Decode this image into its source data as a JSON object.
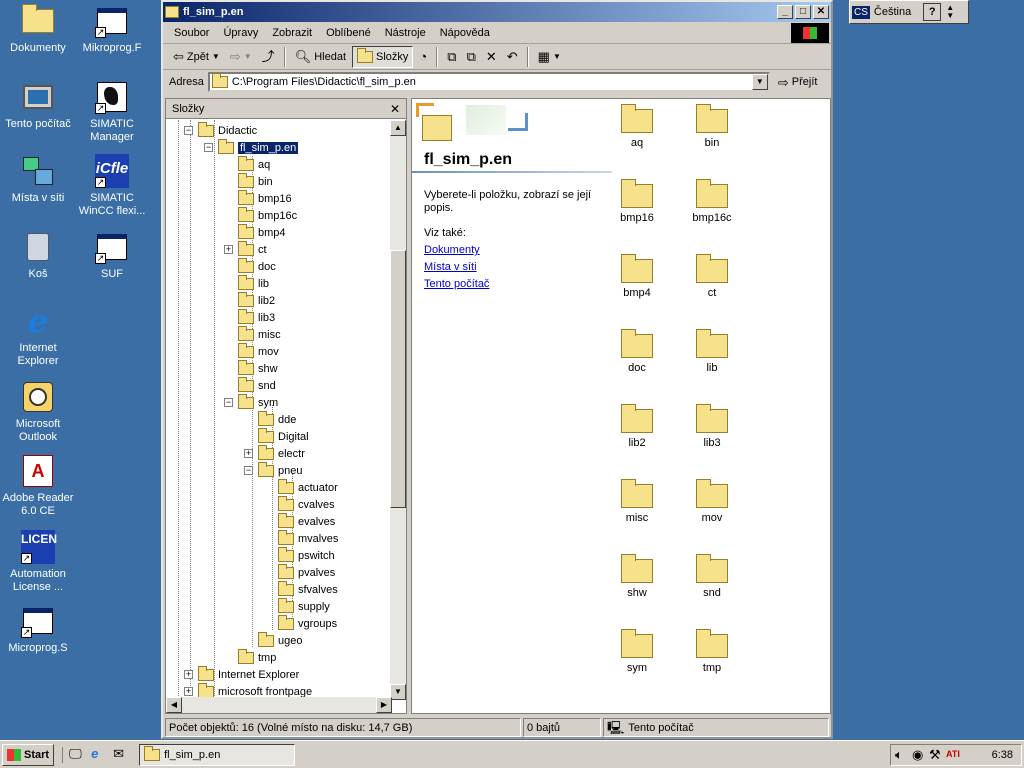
{
  "desktop": {
    "icons": [
      {
        "label": "Dokumenty",
        "icon": "my-documents-icon"
      },
      {
        "label": "Mikroprog.F",
        "icon": "mikroprog-f-icon"
      },
      {
        "label": "Tento počítač",
        "icon": "my-computer-icon"
      },
      {
        "label": "SIMATIC Manager",
        "icon": "simatic-manager-icon"
      },
      {
        "label": "Místa v síti",
        "icon": "network-places-icon"
      },
      {
        "label": "SIMATIC WinCC flexi...",
        "icon": "simatic-wincc-icon"
      },
      {
        "label": "Koš",
        "icon": "recycle-bin-icon"
      },
      {
        "label": "SUF",
        "icon": "suf-icon"
      },
      {
        "label": "Internet Explorer",
        "icon": "internet-explorer-icon"
      },
      {
        "label": "Microsoft Outlook",
        "icon": "outlook-icon"
      },
      {
        "label": "Adobe Reader 6.0 CE",
        "icon": "adobe-reader-icon"
      },
      {
        "label": "Automation License ...",
        "icon": "automation-license-icon"
      },
      {
        "label": "Microprog.S",
        "icon": "microprog-s-icon"
      }
    ],
    "icon_glyph_text": {
      "adobe": "A",
      "licen": "LICEN",
      "wincc": "iCfle"
    }
  },
  "langbar": {
    "code": "CS",
    "language": "Čeština",
    "help": "?"
  },
  "window": {
    "title": "fl_sim_p.en",
    "menu": [
      "Soubor",
      "Úpravy",
      "Zobrazit",
      "Oblíbené",
      "Nástroje",
      "Nápověda"
    ],
    "toolbar": {
      "back": "Zpět",
      "search": "Hledat",
      "folders": "Složky"
    },
    "address": {
      "label": "Adresa",
      "value": "C:\\Program Files\\Didactic\\fl_sim_p.en",
      "go": "Přejít"
    },
    "folders_pane": {
      "title": "Složky",
      "tree": [
        {
          "label": "Didactic",
          "level": 0,
          "expander": "−"
        },
        {
          "label": "fl_sim_p.en",
          "level": 1,
          "expander": "−",
          "selected": true
        },
        {
          "label": "aq",
          "level": 2
        },
        {
          "label": "bin",
          "level": 2
        },
        {
          "label": "bmp16",
          "level": 2
        },
        {
          "label": "bmp16c",
          "level": 2
        },
        {
          "label": "bmp4",
          "level": 2
        },
        {
          "label": "ct",
          "level": 2,
          "expander": "+"
        },
        {
          "label": "doc",
          "level": 2
        },
        {
          "label": "lib",
          "level": 2
        },
        {
          "label": "lib2",
          "level": 2
        },
        {
          "label": "lib3",
          "level": 2
        },
        {
          "label": "misc",
          "level": 2
        },
        {
          "label": "mov",
          "level": 2
        },
        {
          "label": "shw",
          "level": 2
        },
        {
          "label": "snd",
          "level": 2
        },
        {
          "label": "sym",
          "level": 2,
          "expander": "−"
        },
        {
          "label": "dde",
          "level": 3
        },
        {
          "label": "Digital",
          "level": 3
        },
        {
          "label": "electr",
          "level": 3,
          "expander": "+"
        },
        {
          "label": "pneu",
          "level": 3,
          "expander": "−"
        },
        {
          "label": "actuator",
          "level": 4
        },
        {
          "label": "cvalves",
          "level": 4
        },
        {
          "label": "evalves",
          "level": 4
        },
        {
          "label": "mvalves",
          "level": 4
        },
        {
          "label": "pswitch",
          "level": 4
        },
        {
          "label": "pvalves",
          "level": 4
        },
        {
          "label": "sfvalves",
          "level": 4
        },
        {
          "label": "supply",
          "level": 4
        },
        {
          "label": "vgroups",
          "level": 4
        },
        {
          "label": "ugeo",
          "level": 3
        },
        {
          "label": "tmp",
          "level": 2
        },
        {
          "label": "Internet Explorer",
          "level": 0,
          "expander": "+"
        },
        {
          "label": "microsoft frontpage",
          "level": 0,
          "expander": "+"
        }
      ]
    },
    "info": {
      "title": "fl_sim_p.en",
      "description": "Vyberete-li položku, zobrazí se její popis.",
      "see_also": "Viz také:",
      "links": [
        "Dokumenty",
        "Místa v síti",
        "Tento počítač"
      ]
    },
    "items": [
      "aq",
      "bin",
      "bmp16",
      "bmp16c",
      "bmp4",
      "ct",
      "doc",
      "lib",
      "lib2",
      "lib3",
      "misc",
      "mov",
      "shw",
      "snd",
      "sym",
      "tmp"
    ],
    "status": {
      "objects": "Počet objektů: 16 (Volné místo na disku: 14,7 GB)",
      "size": "0 bajtů",
      "location": "Tento počítač"
    }
  },
  "taskbar": {
    "start": "Start",
    "task": "fl_sim_p.en",
    "clock": "6:38"
  }
}
